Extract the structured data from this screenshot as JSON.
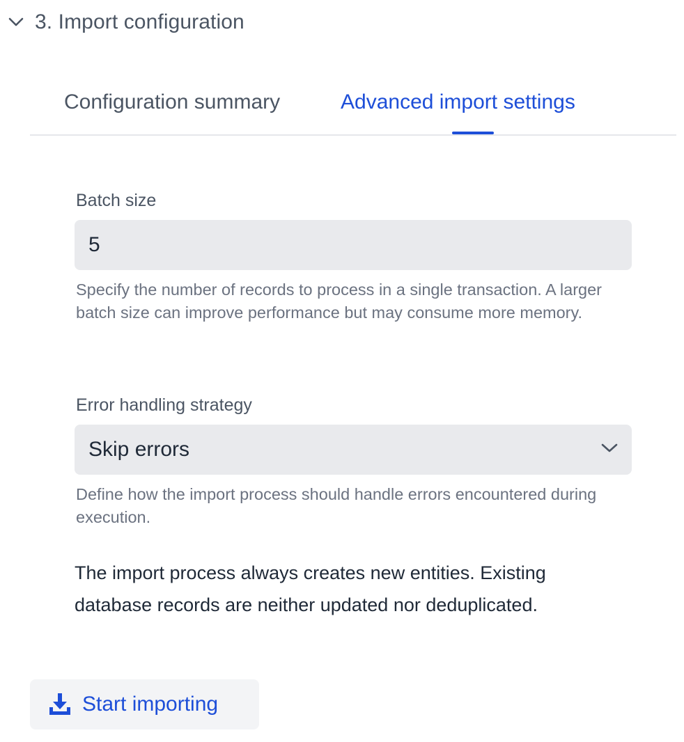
{
  "section": {
    "title": "3. Import configuration",
    "icon": "chevron-down-icon"
  },
  "tabs": [
    {
      "label": "Configuration summary",
      "active": false
    },
    {
      "label": "Advanced import settings",
      "active": true
    }
  ],
  "batch_size": {
    "label": "Batch size",
    "value": "5",
    "help": "Specify the number of records to process in a single transaction. A larger batch size can improve performance but may consume more memory."
  },
  "error_handling": {
    "label": "Error handling strategy",
    "selected": "Skip errors",
    "icon": "chevron-down-icon",
    "help": "Define how the import process should handle errors encountered during execution."
  },
  "note": "The import process always creates new entities. Existing database records are neither updated nor deduplicated.",
  "start_button": {
    "label": "Start importing",
    "icon": "download-icon"
  },
  "colors": {
    "accent": "#1d4ed8",
    "muted_text": "#4b5563",
    "help_text": "#6b7280",
    "input_bg": "#e9eaed",
    "button_bg": "#f3f4f6"
  }
}
